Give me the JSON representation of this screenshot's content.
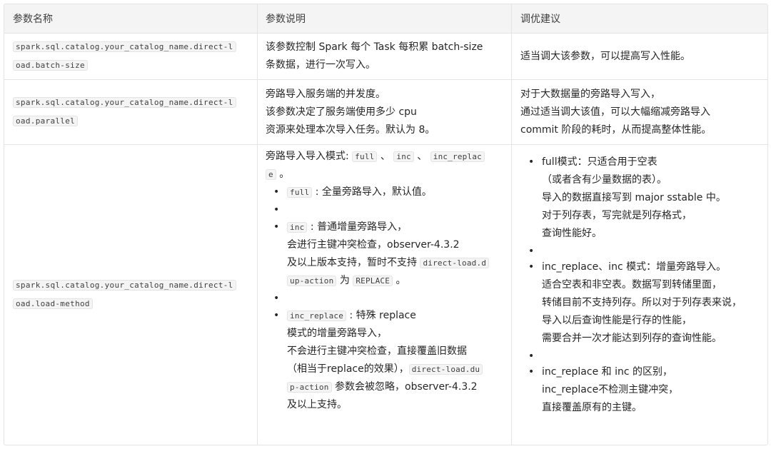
{
  "header": {
    "col1": "参数名称",
    "col2": "参数说明",
    "col3": "调优建议"
  },
  "rows": [
    {
      "name_line1": "spark.sql.catalog.your_catalog_name.direct-l",
      "name_line2": "oad.batch-size",
      "desc_line1": "该参数控制 Spark 每个 Task 每积累 batch-size",
      "desc_line2": "条数据，进行一次写入。",
      "advice": "适当调大该参数，可以提高写入性能。"
    },
    {
      "name_line1": "spark.sql.catalog.your_catalog_name.direct-l",
      "name_line2": "oad.parallel",
      "desc_line1": "旁路导入服务端的并发度。",
      "desc_line2": "该参数决定了服务端使用多少 cpu",
      "desc_line3": "资源来处理本次导入任务。默认为 8。",
      "advice_line1": "对于大数据量的旁路导入写入，",
      "advice_line2": "通过适当调大该值，可以大幅缩减旁路导入",
      "advice_line3": "commit 阶段的耗时，从而提高整体性能。"
    },
    {
      "name_line1": "spark.sql.catalog.your_catalog_name.direct-l",
      "name_line2": "oad.load-method",
      "intro_text": "旁路导入导入模式: ",
      "intro_code1": "full",
      "intro_sep1": " 、 ",
      "intro_code2": "inc",
      "intro_sep2": " 、 ",
      "intro_code3a": "inc_replac",
      "intro_code3b": "e",
      "intro_end": " 。",
      "b1_code": "full",
      "b1_text": " : 全量旁路导入，默认值。",
      "b2_code": "inc",
      "b2_text": " : 普通增量旁路导入，",
      "b2_line2": "会进行主键冲突检查，observer-4.3.2",
      "b2_line3_text": "及以上版本支持，暂时不支持 ",
      "b2_line3_code": "direct-load.d",
      "b2_line4_code": "up-action",
      "b2_line4_mid": " 为 ",
      "b2_line4_code2": "REPLACE",
      "b2_line4_end": " 。",
      "b3_code": "inc_replace",
      "b3_text": " : 特殊 replace",
      "b3_line2": "模式的增量旁路导入，",
      "b3_line3": "不会进行主键冲突检查，直接覆盖旧数据",
      "b3_line4_text": "（相当于replace的效果），",
      "b3_line4_code": "direct-load.du",
      "b3_line5_code": "p-action",
      "b3_line5_text": " 参数会被忽略，observer-4.3.2",
      "b3_line6": "及以上支持。",
      "a1_line1": "full模式：只适合用于空表",
      "a1_line2": "（或者含有少量数据的表）。",
      "a1_line3": "导入的数据直接写到 major sstable 中。",
      "a1_line4": "对于列存表，写完就是列存格式，",
      "a1_line5": "查询性能好。",
      "a2_line1": "inc_replace、inc 模式：增量旁路导入。",
      "a2_line2": "适合空表和非空表。数据写到转储里面，",
      "a2_line3": "转储目前不支持列存。所以对于列存表来说，",
      "a2_line4": "导入以后查询性能是行存的性能，",
      "a2_line5": "需要合并一次才能达到列存的查询性能。",
      "a3_line1": "inc_replace 和 inc 的区别，",
      "a3_line2": "inc_replace不检测主键冲突，",
      "a3_line3": "直接覆盖原有的主键。"
    }
  ]
}
